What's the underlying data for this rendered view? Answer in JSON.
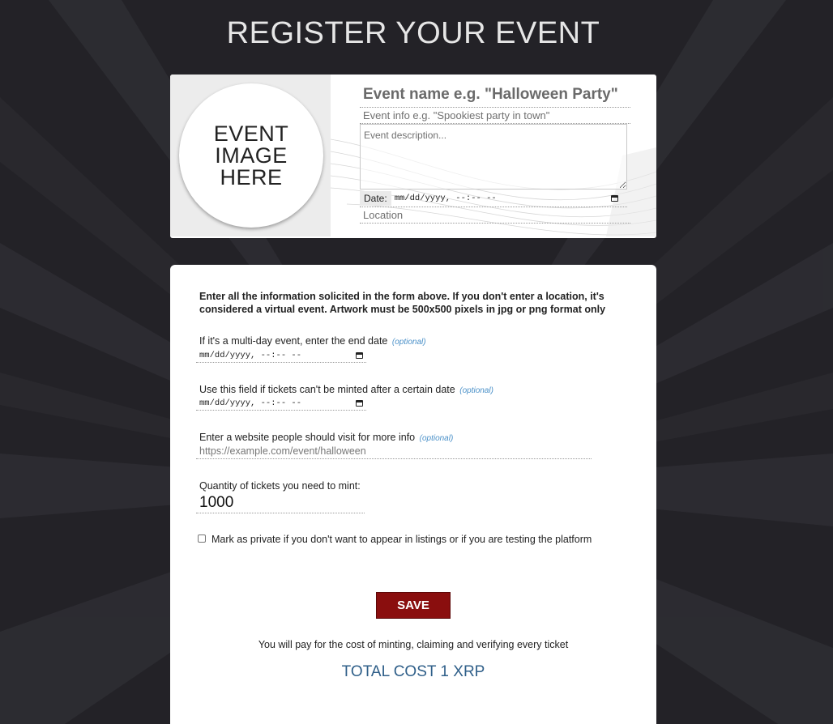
{
  "page": {
    "title": "REGISTER YOUR EVENT"
  },
  "event_card": {
    "image_placeholder": "EVENT\nIMAGE\nHERE",
    "name_placeholder": "Event name e.g. \"Halloween Party\"",
    "info_placeholder": "Event info e.g. \"Spookiest party in town\"",
    "description_placeholder": "Event description...",
    "date_label": "Date:",
    "date_value": "mm/dd/yyyy, --:-- --",
    "location_placeholder": "Location"
  },
  "options": {
    "instructions": "Enter all the information solicited in the form above. If you don't enter a location, it's considered a virtual event. Artwork must be 500x500 pixels in jpg or png format only",
    "end_date_label": "If it's a multi-day event, enter the end date",
    "end_date_value": "mm/dd/yyyy, --:-- --",
    "mint_deadline_label": "Use this field if tickets can't be minted after a certain date",
    "mint_deadline_value": "mm/dd/yyyy, --:-- --",
    "website_label": "Enter a website people should visit for more info",
    "website_placeholder": "https://example.com/event/halloween",
    "optional_tag": "(optional)",
    "quantity_label": "Quantity of tickets you need to mint:",
    "quantity_value": "1000",
    "private_label": "Mark as private if you don't want to appear in listings or if you are testing the platform",
    "private_checked": false,
    "save_label": "SAVE",
    "pay_note": "You will pay for the cost of minting, claiming and verifying every ticket",
    "total_cost": "TOTAL COST 1 XRP"
  },
  "colors": {
    "background": "#232227",
    "save_button": "#8a0e0e",
    "optional_tag": "#4a90c8",
    "total_cost": "#2f5f89"
  }
}
